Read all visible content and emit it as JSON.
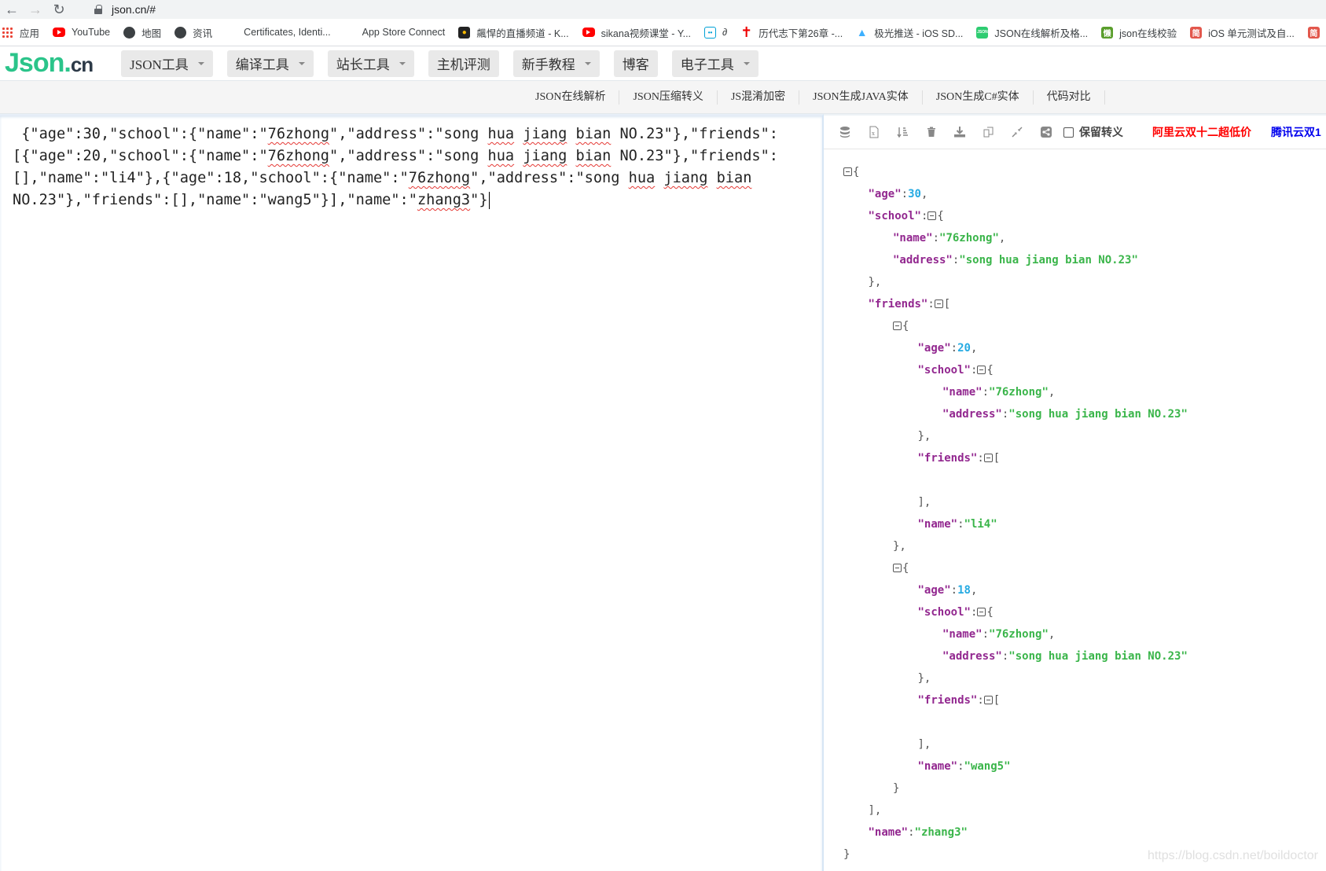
{
  "browser": {
    "url": "json.cn/#",
    "bookmarks": [
      {
        "label": "应用",
        "icon": "apps-grid-icon"
      },
      {
        "label": "YouTube",
        "icon": "youtube-icon"
      },
      {
        "label": "地图",
        "icon": "globe-icon"
      },
      {
        "label": "资讯",
        "icon": "globe-icon"
      },
      {
        "label": "Certificates, Identi...",
        "icon": "apple-icon"
      },
      {
        "label": "App Store Connect",
        "icon": "apple-icon"
      },
      {
        "label": "飆悍的直播频道 - K...",
        "icon": "monkey-icon"
      },
      {
        "label": "sikana视频课堂 - Y...",
        "icon": "youtube-icon"
      },
      {
        "label": "∂",
        "icon": "bilibili-icon"
      },
      {
        "label": "历代志下第26章 -...",
        "icon": "red-cross-icon"
      },
      {
        "label": "极光推送 - iOS SD...",
        "icon": "jiguang-icon"
      },
      {
        "label": "JSON在线解析及格...",
        "icon": "json-icon"
      },
      {
        "label": "json在线校验",
        "icon": "lan-icon"
      },
      {
        "label": "iOS 单元测试及自...",
        "icon": "jianshu-icon"
      },
      {
        "label": "",
        "icon": "jianshu-icon"
      }
    ]
  },
  "site": {
    "logo_main": "Json",
    "logo_dot": ".",
    "logo_suffix": "cn",
    "menu": [
      {
        "label": "JSON工具",
        "dropdown": true
      },
      {
        "label": "编译工具",
        "dropdown": true
      },
      {
        "label": "站长工具",
        "dropdown": true
      },
      {
        "label": "主机评测",
        "dropdown": false
      },
      {
        "label": "新手教程",
        "dropdown": true
      },
      {
        "label": "博客",
        "dropdown": false
      },
      {
        "label": "电子工具",
        "dropdown": true
      }
    ],
    "subnav": [
      "JSON在线解析",
      "JSON压缩转义",
      "JS混淆加密",
      "JSON生成JAVA实体",
      "JSON生成C#实体",
      "代码对比"
    ]
  },
  "editor": {
    "text_segments": [
      " {\"age\":30,\"school\":{\"name\":\"",
      "76zhong",
      "\",\"address\":\"song ",
      "hua",
      " ",
      "jiang",
      " ",
      "bian",
      " NO.23\"},\"friends\":\n[{\"age\":20,\"school\":{\"name\":\"",
      "76zhong",
      "\",\"address\":\"song ",
      "hua",
      " ",
      "jiang",
      " ",
      "bian",
      " NO.23\"},\"friends\":\n[],\"name\":\"li4\"},{\"age\":18,\"school\":{\"name\":\"",
      "76zhong",
      "\",\"address\":\"song ",
      "hua",
      " ",
      "jiang",
      " ",
      "bian",
      "\nNO.23\"},\"friends\":[],\"name\":\"wang5\"}],\"name\":\"",
      "zhang3",
      "\"}"
    ],
    "spellcheck_flagged_segment_indexes": [
      1,
      3,
      5,
      7,
      9,
      11,
      13,
      15,
      17,
      19,
      21,
      23,
      25
    ]
  },
  "toolbar": {
    "icons": [
      "database-icon",
      "excel-export-icon",
      "sort-icon",
      "trash-icon",
      "download-icon",
      "copy-icon",
      "compress-icon",
      "share-icon"
    ],
    "keep_escape_label": "保留转义",
    "keep_escape_checked": false,
    "promo_aliyun": "阿里云双十二超低价",
    "promo_tencent": "腾讯云双1"
  },
  "tree": {
    "lines": [
      {
        "indent": 0,
        "parts": [
          [
            "toggle",
            ""
          ],
          [
            "p",
            "{"
          ]
        ]
      },
      {
        "indent": 1,
        "parts": [
          [
            "k",
            "\"age\""
          ],
          [
            "p",
            ":"
          ],
          [
            "n",
            "30"
          ],
          [
            "p",
            ","
          ]
        ]
      },
      {
        "indent": 1,
        "parts": [
          [
            "k",
            "\"school\""
          ],
          [
            "p",
            ":"
          ],
          [
            "toggle",
            ""
          ],
          [
            "p",
            "{"
          ]
        ]
      },
      {
        "indent": 2,
        "parts": [
          [
            "k",
            "\"name\""
          ],
          [
            "p",
            ":"
          ],
          [
            "s",
            "\"76zhong\""
          ],
          [
            "p",
            ","
          ]
        ]
      },
      {
        "indent": 2,
        "parts": [
          [
            "k",
            "\"address\""
          ],
          [
            "p",
            ":"
          ],
          [
            "s",
            "\"song hua jiang bian NO.23\""
          ]
        ]
      },
      {
        "indent": 1,
        "parts": [
          [
            "p",
            "},"
          ]
        ]
      },
      {
        "indent": 1,
        "parts": [
          [
            "k",
            "\"friends\""
          ],
          [
            "p",
            ":"
          ],
          [
            "toggle",
            ""
          ],
          [
            "p",
            "["
          ]
        ]
      },
      {
        "indent": 2,
        "parts": [
          [
            "toggle",
            ""
          ],
          [
            "p",
            "{"
          ]
        ]
      },
      {
        "indent": 3,
        "parts": [
          [
            "k",
            "\"age\""
          ],
          [
            "p",
            ":"
          ],
          [
            "n",
            "20"
          ],
          [
            "p",
            ","
          ]
        ]
      },
      {
        "indent": 3,
        "parts": [
          [
            "k",
            "\"school\""
          ],
          [
            "p",
            ":"
          ],
          [
            "toggle",
            ""
          ],
          [
            "p",
            "{"
          ]
        ]
      },
      {
        "indent": 4,
        "parts": [
          [
            "k",
            "\"name\""
          ],
          [
            "p",
            ":"
          ],
          [
            "s",
            "\"76zhong\""
          ],
          [
            "p",
            ","
          ]
        ]
      },
      {
        "indent": 4,
        "parts": [
          [
            "k",
            "\"address\""
          ],
          [
            "p",
            ":"
          ],
          [
            "s",
            "\"song hua jiang bian NO.23\""
          ]
        ]
      },
      {
        "indent": 3,
        "parts": [
          [
            "p",
            "},"
          ]
        ]
      },
      {
        "indent": 3,
        "parts": [
          [
            "k",
            "\"friends\""
          ],
          [
            "p",
            ":"
          ],
          [
            "toggle",
            ""
          ],
          [
            "p",
            "["
          ]
        ]
      },
      {
        "indent": 3,
        "parts": []
      },
      {
        "indent": 3,
        "parts": [
          [
            "p",
            "],"
          ]
        ]
      },
      {
        "indent": 3,
        "parts": [
          [
            "k",
            "\"name\""
          ],
          [
            "p",
            ":"
          ],
          [
            "s",
            "\"li4\""
          ]
        ]
      },
      {
        "indent": 2,
        "parts": [
          [
            "p",
            "},"
          ]
        ]
      },
      {
        "indent": 2,
        "parts": [
          [
            "toggle",
            ""
          ],
          [
            "p",
            "{"
          ]
        ]
      },
      {
        "indent": 3,
        "parts": [
          [
            "k",
            "\"age\""
          ],
          [
            "p",
            ":"
          ],
          [
            "n",
            "18"
          ],
          [
            "p",
            ","
          ]
        ]
      },
      {
        "indent": 3,
        "parts": [
          [
            "k",
            "\"school\""
          ],
          [
            "p",
            ":"
          ],
          [
            "toggle",
            ""
          ],
          [
            "p",
            "{"
          ]
        ]
      },
      {
        "indent": 4,
        "parts": [
          [
            "k",
            "\"name\""
          ],
          [
            "p",
            ":"
          ],
          [
            "s",
            "\"76zhong\""
          ],
          [
            "p",
            ","
          ]
        ]
      },
      {
        "indent": 4,
        "parts": [
          [
            "k",
            "\"address\""
          ],
          [
            "p",
            ":"
          ],
          [
            "s",
            "\"song hua jiang bian NO.23\""
          ]
        ]
      },
      {
        "indent": 3,
        "parts": [
          [
            "p",
            "},"
          ]
        ]
      },
      {
        "indent": 3,
        "parts": [
          [
            "k",
            "\"friends\""
          ],
          [
            "p",
            ":"
          ],
          [
            "toggle",
            ""
          ],
          [
            "p",
            "["
          ]
        ]
      },
      {
        "indent": 3,
        "parts": []
      },
      {
        "indent": 3,
        "parts": [
          [
            "p",
            "],"
          ]
        ]
      },
      {
        "indent": 3,
        "parts": [
          [
            "k",
            "\"name\""
          ],
          [
            "p",
            ":"
          ],
          [
            "s",
            "\"wang5\""
          ]
        ]
      },
      {
        "indent": 2,
        "parts": [
          [
            "p",
            "}"
          ]
        ]
      },
      {
        "indent": 1,
        "parts": [
          [
            "p",
            "],"
          ]
        ]
      },
      {
        "indent": 1,
        "parts": [
          [
            "k",
            "\"name\""
          ],
          [
            "p",
            ":"
          ],
          [
            "s",
            "\"zhang3\""
          ]
        ]
      },
      {
        "indent": 0,
        "parts": [
          [
            "p",
            "}"
          ]
        ]
      }
    ]
  },
  "watermark": "https://blog.csdn.net/boildoctor"
}
